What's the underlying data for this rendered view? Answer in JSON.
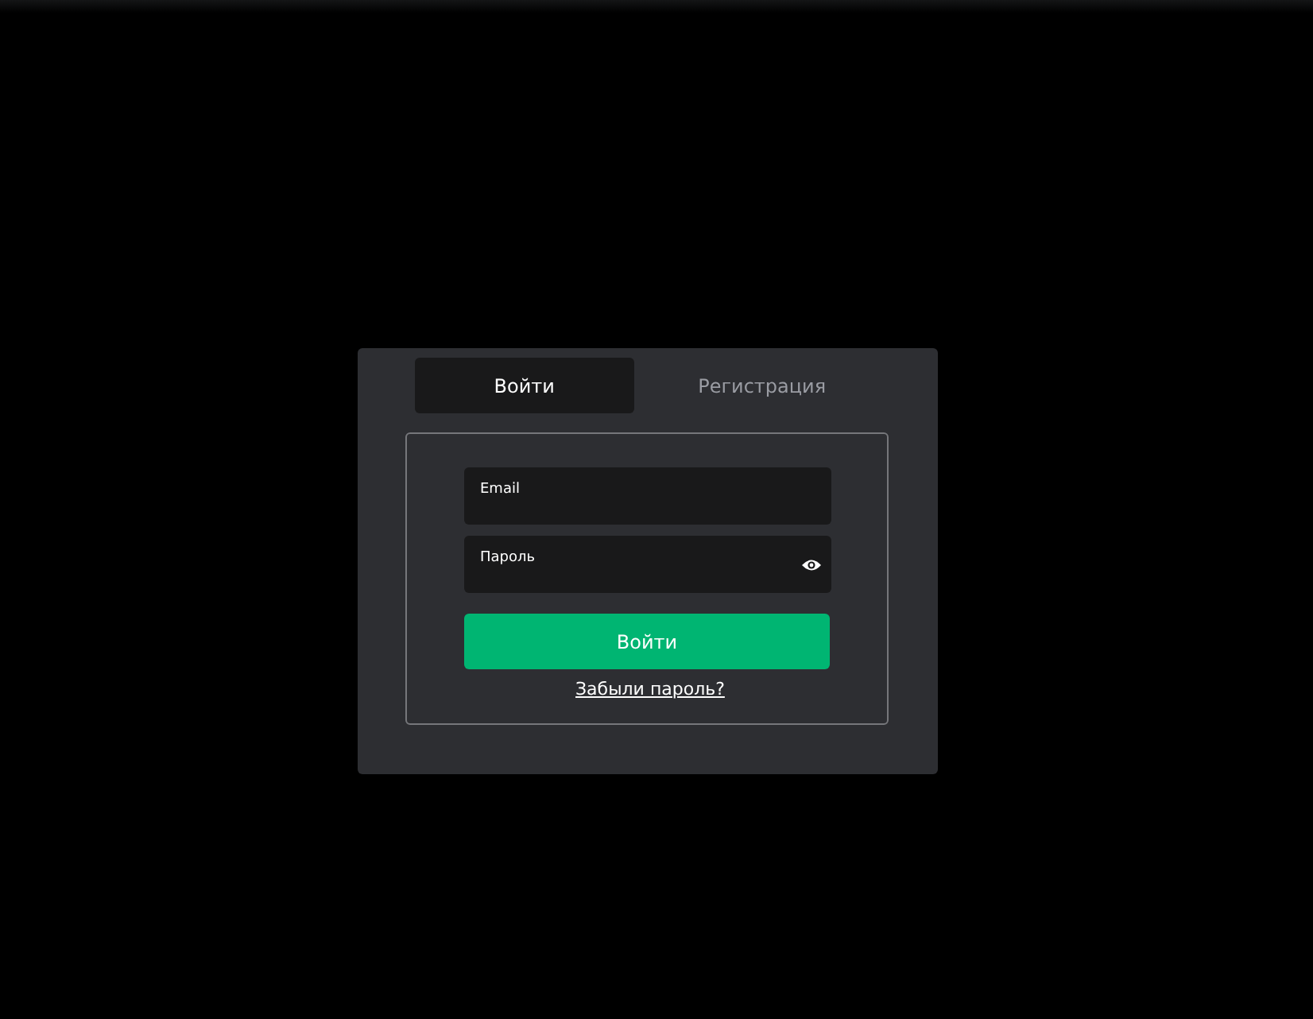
{
  "tabs": [
    {
      "label": "Войти",
      "selected": true
    },
    {
      "label": "Регистрация",
      "selected": false
    }
  ],
  "fields": [
    {
      "label": "Email",
      "password_toggle": false
    },
    {
      "label": "Пароль",
      "password_toggle": true
    }
  ],
  "submit_button": "Войти",
  "forgot_link": "Забыли пароль?"
}
